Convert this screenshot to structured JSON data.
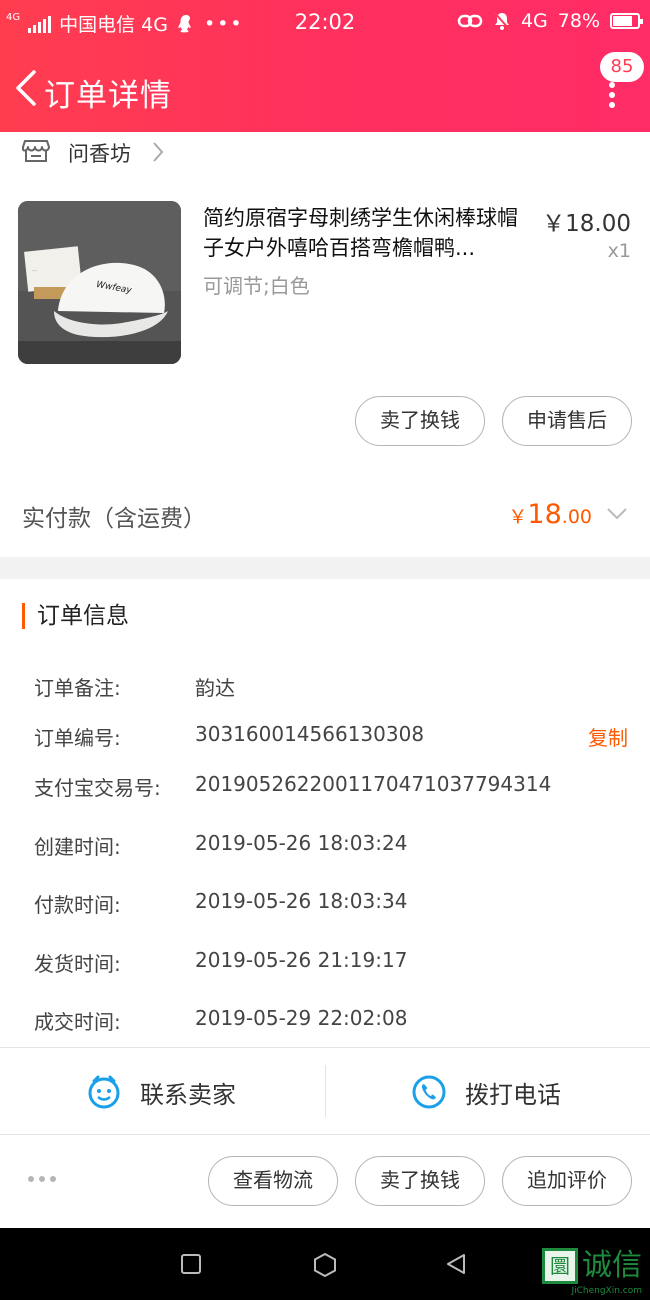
{
  "status_bar": {
    "network_badge": "4G",
    "carrier": "中国电信 4G",
    "time": "22:02",
    "network": "4G",
    "battery_text": "78%",
    "battery_level_percent": 78
  },
  "nav": {
    "title": "订单详情",
    "badge_count": "85"
  },
  "shop": {
    "name": "问香坊"
  },
  "product": {
    "title": "简约原宿字母刺绣学生休闲棒球帽子女户外嘻哈百搭弯檐帽鸭...",
    "spec": "可调节;白色",
    "price": "￥18.00",
    "quantity": "x1",
    "hat_text": "Wwfeay",
    "card_text": "..."
  },
  "product_actions": {
    "sell_exchange": "卖了换钱",
    "after_sale": "申请售后"
  },
  "payment": {
    "label": "实付款（含运费）",
    "currency": "￥",
    "amount_int": "18",
    "amount_dec": ".00"
  },
  "order_info": {
    "section_title": "订单信息",
    "copy_label": "复制",
    "rows": [
      {
        "key": "订单备注:",
        "value": "韵达"
      },
      {
        "key": "订单编号:",
        "value": "303160014566130308"
      },
      {
        "key": "支付宝交易号:",
        "value": "2019052622001170471037794314"
      },
      {
        "key": "创建时间:",
        "value": "2019-05-26 18:03:24"
      },
      {
        "key": "付款时间:",
        "value": "2019-05-26 18:03:34"
      },
      {
        "key": "发货时间:",
        "value": "2019-05-26 21:19:17"
      },
      {
        "key": "成交时间:",
        "value": "2019-05-29 22:02:08"
      }
    ]
  },
  "contact": {
    "seller": "联系卖家",
    "phone": "拨打电话"
  },
  "bottom_actions": {
    "logistics": "查看物流",
    "sell_exchange": "卖了换钱",
    "add_review": "追加评价"
  },
  "watermark": {
    "mark": "圜",
    "text": "诚信",
    "sub": "JiChengXin.com"
  },
  "colors": {
    "header_gradient_start": "#ff3d4f",
    "header_gradient_end": "#ff2c66",
    "accent_orange": "#ff5a00",
    "icon_blue": "#1aa0e8"
  },
  "icons": {
    "back": "chevron-left-icon",
    "more": "more-vertical-icon",
    "store": "store-icon",
    "shop_chevron": "chevron-right-icon",
    "payment_expand": "chevron-down-icon",
    "seller": "chat-face-icon",
    "phone": "phone-icon",
    "more_actions": "ellipsis-icon"
  }
}
